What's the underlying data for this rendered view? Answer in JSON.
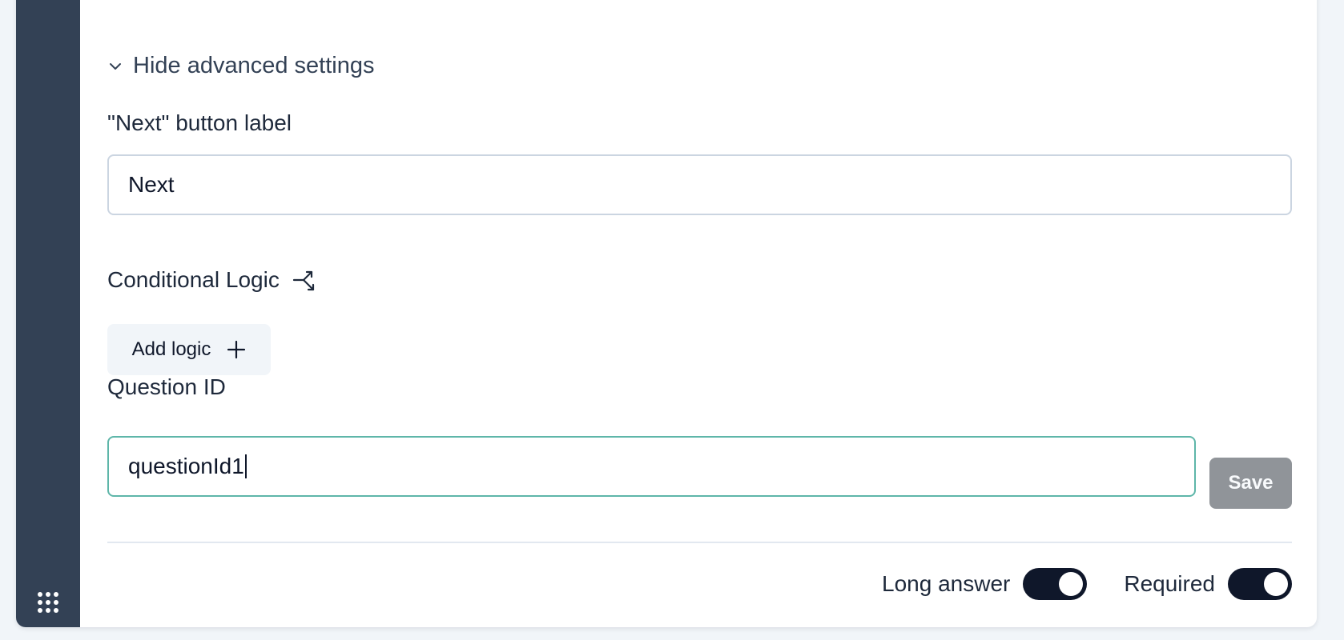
{
  "sidebar": {
    "apps_icon": "grid-dots-icon",
    "background_color": "#334155"
  },
  "advanced": {
    "toggle_label": "Hide advanced settings",
    "toggle_icon": "chevron-down-icon"
  },
  "next_button": {
    "label": "\"Next\" button label",
    "value": "Next"
  },
  "conditional_logic": {
    "label": "Conditional Logic",
    "icon": "split-arrow-icon",
    "add_button_label": "Add logic",
    "add_button_icon": "plus-icon"
  },
  "question_id": {
    "label": "Question ID",
    "value": "questionId1",
    "save_label": "Save",
    "focus_color": "#5eb6a9"
  },
  "toggles": {
    "long_answer": {
      "label": "Long answer",
      "on": true
    },
    "required": {
      "label": "Required",
      "on": true
    }
  }
}
